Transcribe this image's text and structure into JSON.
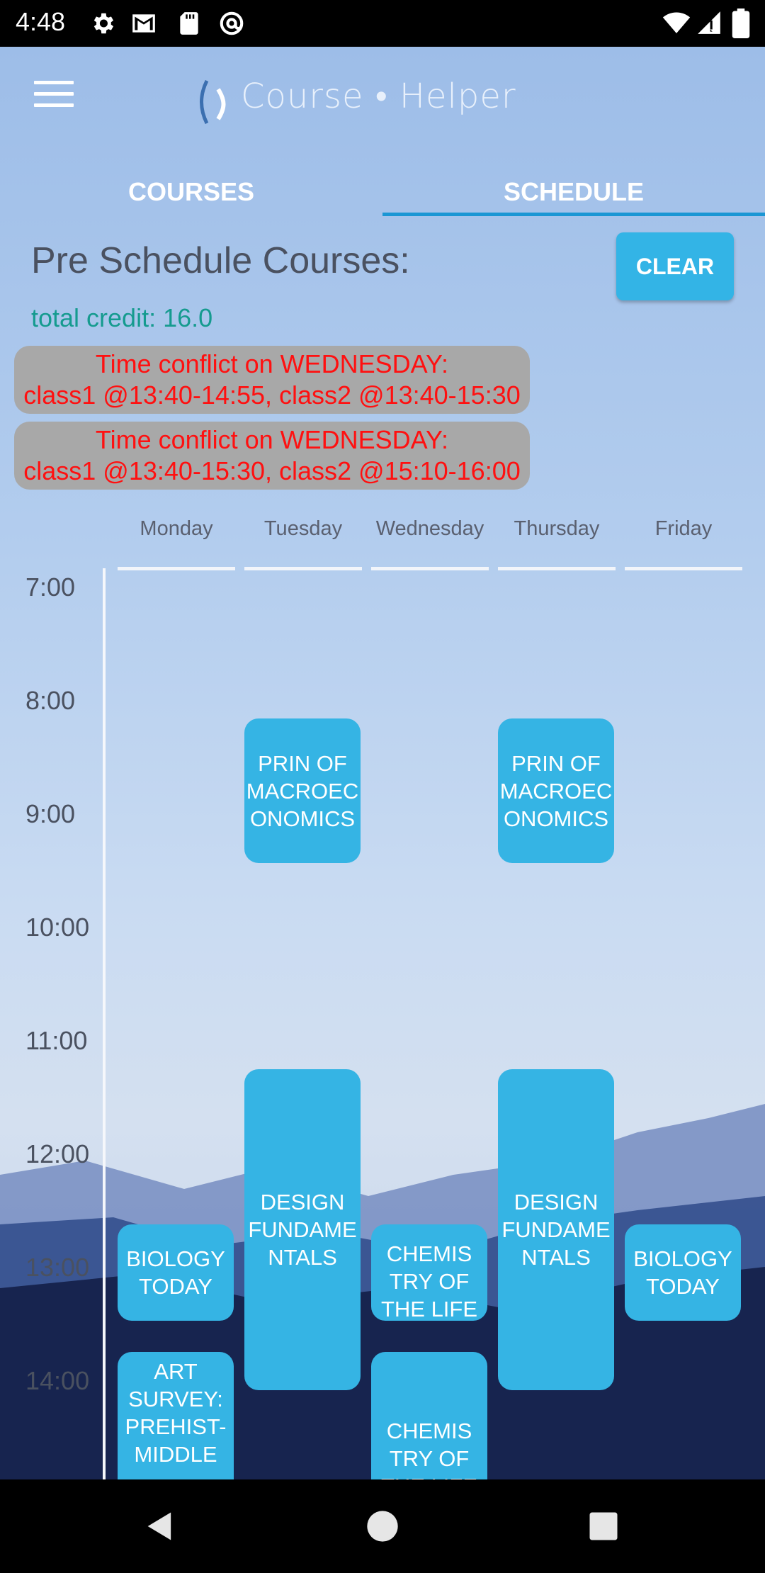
{
  "status_bar": {
    "time": "4:48",
    "icons": [
      "settings-icon",
      "gmail-icon",
      "sd-card-icon",
      "at-sign-icon",
      "wifi-icon",
      "signal-icon",
      "battery-icon"
    ]
  },
  "header": {
    "app_name": "Course • Helper",
    "menu_icon": "hamburger-menu-icon"
  },
  "tabs": [
    {
      "label": "COURSES",
      "selected": false
    },
    {
      "label": "SCHEDULE",
      "selected": true
    }
  ],
  "schedule": {
    "title": "Pre Schedule Courses:",
    "clear_label": "CLEAR",
    "total_credit": "total credit: 16.0",
    "conflicts": [
      {
        "line1": "Time conflict on WEDNESDAY:",
        "line2": "class1 @13:40-14:55, class2 @13:40-15:30"
      },
      {
        "line1": "Time conflict on WEDNESDAY:",
        "line2": "class1 @13:40-15:30, class2 @15:10-16:00"
      }
    ],
    "days": [
      "Monday",
      "Tuesday",
      "Wednesday",
      "Thursday",
      "Friday"
    ],
    "hours": [
      "7:00",
      "8:00",
      "9:00",
      "10:00",
      "11:00",
      "12:00",
      "13:00",
      "14:00"
    ],
    "courses": [
      {
        "name": "PRIN OF MACROEC ONOMICS",
        "day": "Tuesday"
      },
      {
        "name": "PRIN OF MACROEC ONOMICS",
        "day": "Thursday"
      },
      {
        "name": "DESIGN FUNDAME NTALS",
        "day": "Tuesday"
      },
      {
        "name": "DESIGN FUNDAME NTALS",
        "day": "Thursday"
      },
      {
        "name": "BIOLOGY TODAY",
        "day": "Monday"
      },
      {
        "name": "BIOLOGY TODAY",
        "day": "Friday"
      },
      {
        "name": "CHEMIS TRY OF THE LIFE SCI LAB",
        "day": "Wednesday"
      },
      {
        "name": "ART SURVEY: PREHIST-MIDDLE",
        "day": "Monday"
      },
      {
        "name": "CHEMIS TRY OF THE LIFE",
        "day": "Wednesday"
      }
    ]
  },
  "nav_bar": {
    "icons": [
      "back-icon",
      "home-icon",
      "recents-icon"
    ]
  },
  "colors": {
    "accent": "#35b4e6",
    "conflict_text": "#ff1010",
    "credit_text": "#159b8f",
    "tab_indicator": "#1a96d4"
  }
}
